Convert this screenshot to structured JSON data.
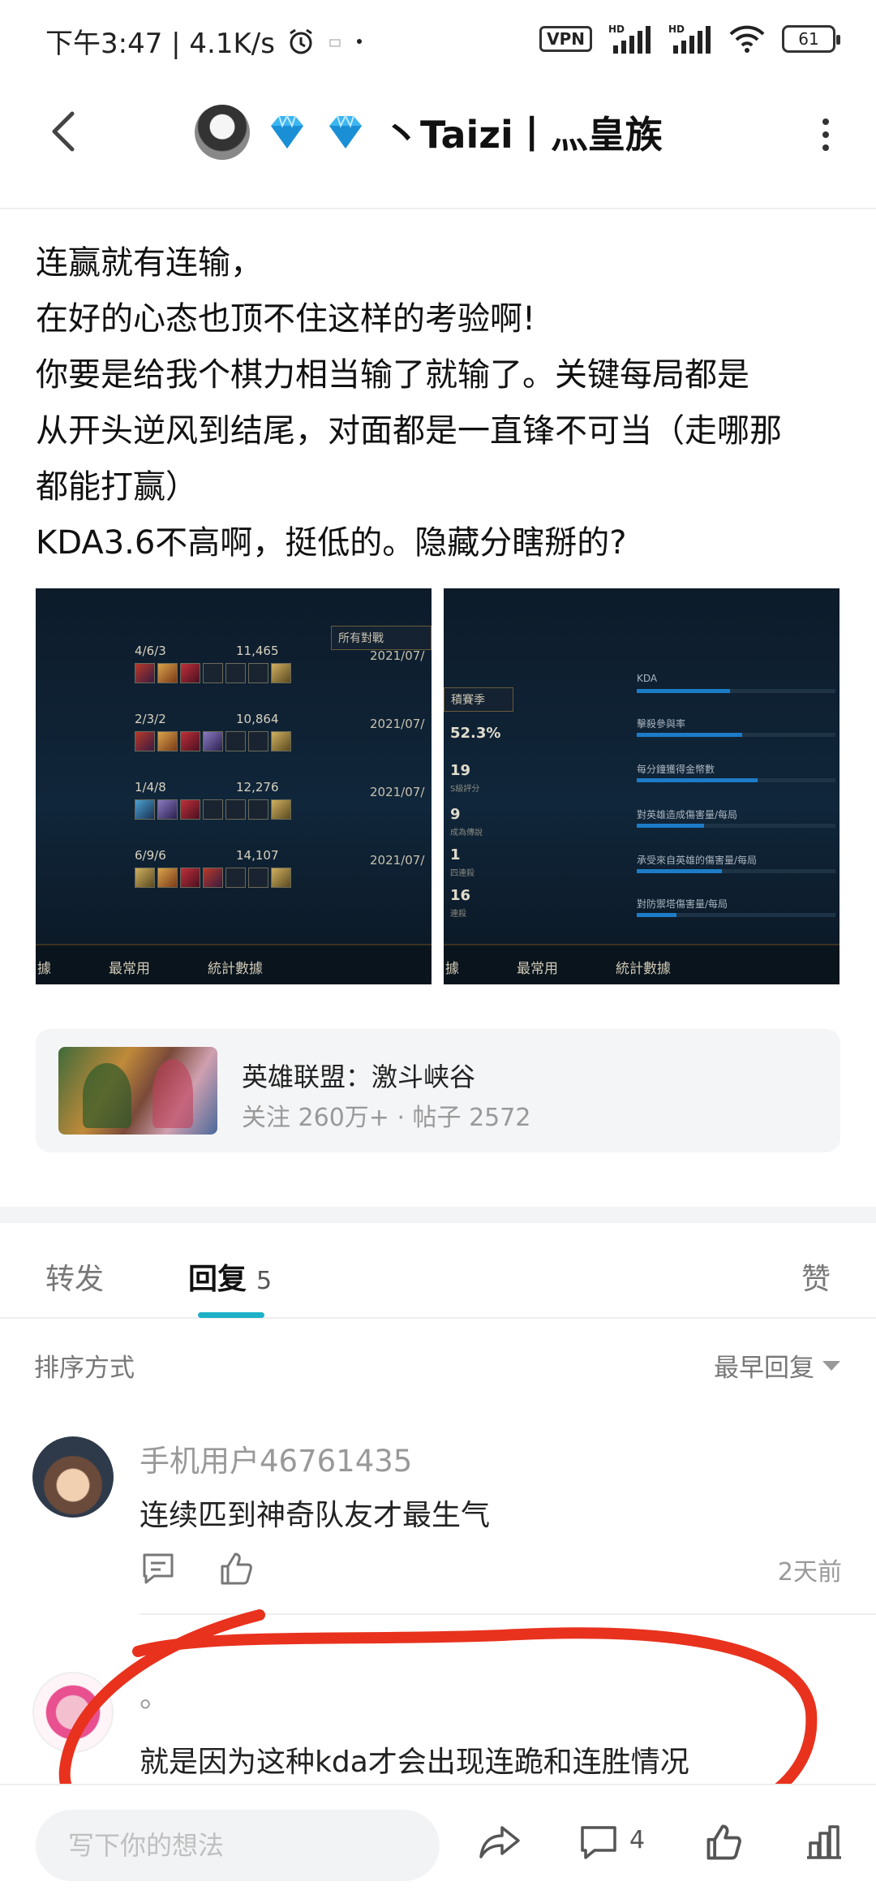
{
  "status_bar": {
    "time_speed": "下午3:47 | 4.1K/s",
    "vpn": "VPN",
    "hd1": "HD",
    "hd2": "HD",
    "battery": "61"
  },
  "header": {
    "title": "丶Taizi丨灬皇族",
    "gem_color": "#2aa8e8"
  },
  "post": {
    "lines": [
      "连赢就有连输，",
      "在好的心态也顶不住这样的考验啊!",
      "你要是给我个棋力相当输了就输了。关键每局都是",
      "从开头逆风到结尾，对面都是一直锋不可当（走哪那",
      "都能打赢）",
      "KDA3.6不高啊，挺低的。隐藏分瞎掰的?"
    ],
    "screenshot1": {
      "filter": "所有對戰",
      "matches": [
        {
          "kda": "4/6/3",
          "gold": "11,465",
          "date": "2021/07/"
        },
        {
          "kda": "2/3/2",
          "gold": "10,864",
          "date": "2021/07/"
        },
        {
          "kda": "1/4/8",
          "gold": "12,276",
          "date": "2021/07/"
        },
        {
          "kda": "6/9/6",
          "gold": "14,107",
          "date": "2021/07/"
        }
      ],
      "tabs": [
        "據",
        "最常用",
        "統計數據"
      ]
    },
    "screenshot2": {
      "filter": "積賽季",
      "stats": [
        {
          "value": "52.3%",
          "label": ""
        },
        {
          "value": "19",
          "label": "S級評分"
        },
        {
          "value": "9",
          "label": "成為傳說"
        },
        {
          "value": "1",
          "label": "四連殺"
        },
        {
          "value": "16",
          "label": "連殺"
        }
      ],
      "bars": [
        {
          "label": "KDA",
          "fill": 0.47
        },
        {
          "label": "擊殺參與率",
          "fill": 0.53
        },
        {
          "label": "每分鐘獲得金幣數",
          "fill": 0.61
        },
        {
          "label": "對英雄造成傷害量/每局",
          "fill": 0.34
        },
        {
          "label": "承受來自英雄的傷害量/每局",
          "fill": 0.43
        },
        {
          "label": "對防禦塔傷害量/每局",
          "fill": 0.2
        }
      ],
      "tabs": [
        "據",
        "最常用",
        "統計數據"
      ]
    }
  },
  "community": {
    "name": "英雄联盟：激斗峡谷",
    "meta": "关注 260万+  ·  帖子 2572"
  },
  "tabs": {
    "forward": "转发",
    "reply": "回复",
    "reply_count": "5",
    "like": "赞"
  },
  "sort": {
    "label": "排序方式",
    "value": "最早回复"
  },
  "replies": [
    {
      "user": "手机用户46761435",
      "text": "连续匹到神奇队友才最生气",
      "time": "2天前"
    },
    {
      "user": "。",
      "text": "就是因为这种kda才会出现连跪和连胜情况",
      "time": ""
    }
  ],
  "bottom_bar": {
    "placeholder": "写下你的想法",
    "comment_count": "4"
  },
  "colors": {
    "accent": "#1cb1c7",
    "annotation": "#e8321e"
  }
}
